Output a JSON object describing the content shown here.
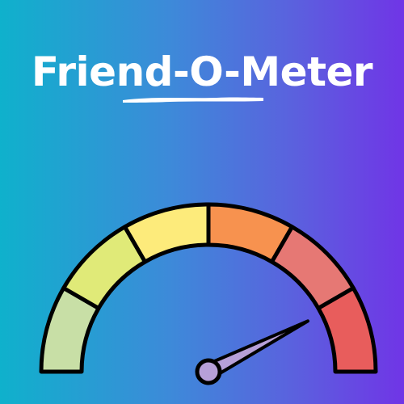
{
  "title": "Friend-O-Meter",
  "gauge": {
    "level": 0.85,
    "segments": [
      {
        "name": "segment-1",
        "color": "#c8dfa6"
      },
      {
        "name": "segment-2",
        "color": "#e0ea78"
      },
      {
        "name": "segment-3",
        "color": "#fdeb7b"
      },
      {
        "name": "segment-4",
        "color": "#f7924f"
      },
      {
        "name": "segment-5",
        "color": "#e67874"
      },
      {
        "name": "segment-6",
        "color": "#e85d5c"
      }
    ],
    "needle_color": "#b7a0d8",
    "outline_color": "#000000"
  },
  "underline_color": "#ffffff"
}
